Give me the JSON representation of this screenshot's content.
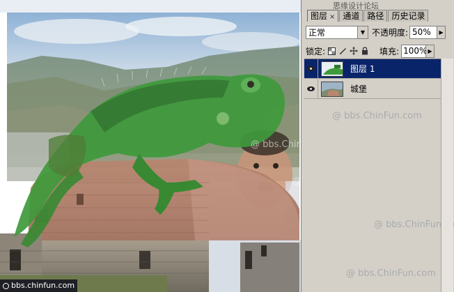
{
  "panel": {
    "title_watermark": "思缘设计论坛",
    "tabs": [
      {
        "label": "图层",
        "close": "×",
        "active": true
      },
      {
        "label": "通道",
        "active": false
      },
      {
        "label": "路径",
        "active": false
      },
      {
        "label": "历史记录",
        "active": false
      }
    ],
    "blend_mode": "正常",
    "opacity_label": "不透明度:",
    "opacity_value": "50%",
    "lock_label": "锁定:",
    "fill_label": "填充:",
    "fill_value": "100%"
  },
  "layers": [
    {
      "name": "图层 1",
      "visible": true,
      "selected": true
    },
    {
      "name": "城堡",
      "visible": true,
      "selected": false
    }
  ],
  "watermarks": {
    "text": "@ bbs.ChinFun.com",
    "corner_url": "bbs.chinfun.com"
  },
  "icons": {
    "dropdown": "chevron-down-icon",
    "slider_arrow": "chevron-right-icon",
    "lock_transparency": "checker-lock-icon",
    "lock_image": "brush-icon",
    "lock_position": "move-icon",
    "lock_all": "lock-icon",
    "visibility": "eye-icon"
  },
  "colors": {
    "panel_bg": "#d4d0c8",
    "selected_row": "#0a246a",
    "iguana_green": "#3f9a3c"
  }
}
